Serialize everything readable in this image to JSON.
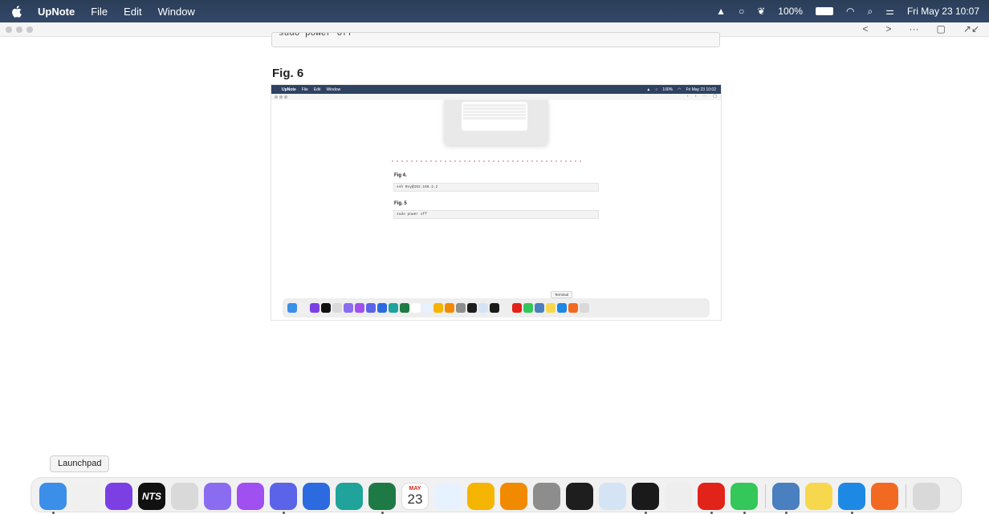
{
  "menubar": {
    "app": "UpNote",
    "menus": [
      "File",
      "Edit",
      "Window"
    ],
    "battery": "100%",
    "clock": "Fri May 23  10:07"
  },
  "titlebar": {
    "ctrls": [
      "<",
      ">",
      "···",
      "▢",
      "↗↙"
    ]
  },
  "top_code": "sudo power off",
  "fig_label": "Fig. 6",
  "inner": {
    "menubar": {
      "app": "UpNote",
      "menus": [
        "File",
        "Edit",
        "Window"
      ],
      "battery": "100%",
      "clock": "Fri May 23  10:02"
    },
    "fig4": "Fig 4.",
    "ssh_code": "ssh Roy@192.168.2.2",
    "fig5": "Fig. 5",
    "power_code": "sudo power off",
    "tooltip": "Terminal"
  },
  "dock": {
    "tooltip": "Launchpad",
    "icons": [
      {
        "name": "Finder",
        "color": "#3b8fe8"
      },
      {
        "name": "Launchpad",
        "color": "#f0f0f0"
      },
      {
        "name": "Tor Browser",
        "color": "#7b3fe4"
      },
      {
        "name": "NTS",
        "color": "#111111"
      },
      {
        "name": "Script Editor",
        "color": "#d9d9d9"
      },
      {
        "name": "Mail",
        "color": "#8a6cf0"
      },
      {
        "name": "Craft",
        "color": "#a04ff0"
      },
      {
        "name": "Vivaldi",
        "color": "#5b63e8"
      },
      {
        "name": "Proton",
        "color": "#2c6ae0"
      },
      {
        "name": "Timing",
        "color": "#1fa39a"
      },
      {
        "name": "Excel",
        "color": "#1d7a44"
      },
      {
        "name": "Calendar",
        "color": "#ffffff"
      },
      {
        "name": "Freeform",
        "color": "#e6f2ff"
      },
      {
        "name": "Photos",
        "color": "#f5b400"
      },
      {
        "name": "VLC",
        "color": "#f28a00"
      },
      {
        "name": "System Settings",
        "color": "#8d8d8d"
      },
      {
        "name": "Activity Monitor",
        "color": "#1e1e1e"
      },
      {
        "name": "Preview",
        "color": "#d5e4f4"
      },
      {
        "name": "Terminal",
        "color": "#1a1a1a"
      },
      {
        "name": "TextEdit",
        "color": "#eeeeee"
      },
      {
        "name": "Opera",
        "color": "#e2231a"
      },
      {
        "name": "Circle",
        "color": "#34c759"
      },
      {
        "name": "Screenshot",
        "color": "#4a7fc0"
      },
      {
        "name": "Notes",
        "color": "#f7d84c"
      },
      {
        "name": "Safari",
        "color": "#1e88e5"
      },
      {
        "name": "UpNote",
        "color": "#f26a21"
      },
      {
        "name": "Trash",
        "color": "#d9d9d9"
      }
    ],
    "calendar_month": "MAY",
    "calendar_day": "23"
  }
}
